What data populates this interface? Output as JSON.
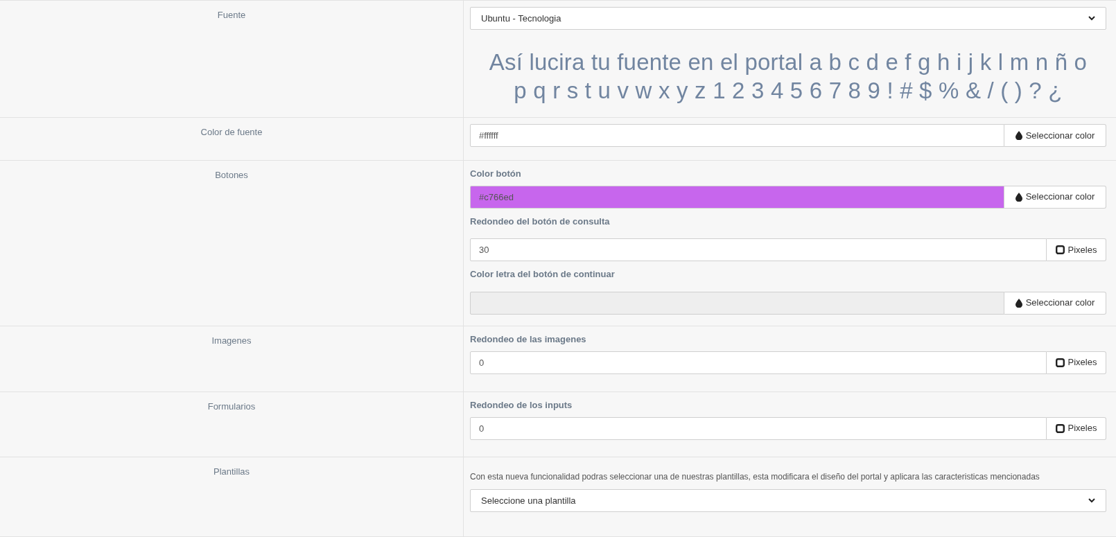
{
  "sections": [
    {
      "label": "Fuente",
      "items": [
        {
          "kind": "select",
          "value": "Ubuntu - Tecnologia"
        },
        {
          "kind": "preview",
          "text": "Así lucira tu fuente en el portal a b c d e f g h i j k l m n ñ o p q r s t u v w x y z 1 2 3 4 5 6 7 8 9 ! # $ % & / ( ) ? ¿"
        }
      ]
    },
    {
      "label": "Color de fuente",
      "items": [
        {
          "kind": "color",
          "value": "#ffffff",
          "color": "#ffffff",
          "disabled": false,
          "button": "Seleccionar color"
        }
      ]
    },
    {
      "label": "Botones",
      "items": [
        {
          "kind": "heading",
          "text": "Color botón"
        },
        {
          "kind": "color",
          "value": "#c766ed",
          "color": "#c766ed",
          "disabled": false,
          "button": "Seleccionar color"
        },
        {
          "kind": "heading",
          "text": "Redondeo del botón de consulta"
        },
        {
          "kind": "number",
          "value": "30",
          "button": "Pixeles"
        },
        {
          "kind": "heading",
          "text": "Color letra del botón de continuar"
        },
        {
          "kind": "color",
          "value": "",
          "disabled": true,
          "button": "Seleccionar color"
        }
      ]
    },
    {
      "label": "Imagenes",
      "items": [
        {
          "kind": "heading",
          "text": "Redondeo de las imagenes"
        },
        {
          "kind": "number",
          "value": "0",
          "button": "Pixeles"
        }
      ]
    },
    {
      "label": "Formularios",
      "items": [
        {
          "kind": "heading",
          "text": "Redondeo de los inputs"
        },
        {
          "kind": "number",
          "value": "0",
          "button": "Pixeles"
        }
      ]
    },
    {
      "label": "Plantillas",
      "items": [
        {
          "kind": "description",
          "text": "Con esta nueva funcionalidad podras seleccionar una de nuestras plantillas, esta modificara el diseño del portal y aplicara las caracteristicas mencionadas"
        },
        {
          "kind": "select",
          "value": "Seleccione una plantilla"
        }
      ]
    }
  ]
}
